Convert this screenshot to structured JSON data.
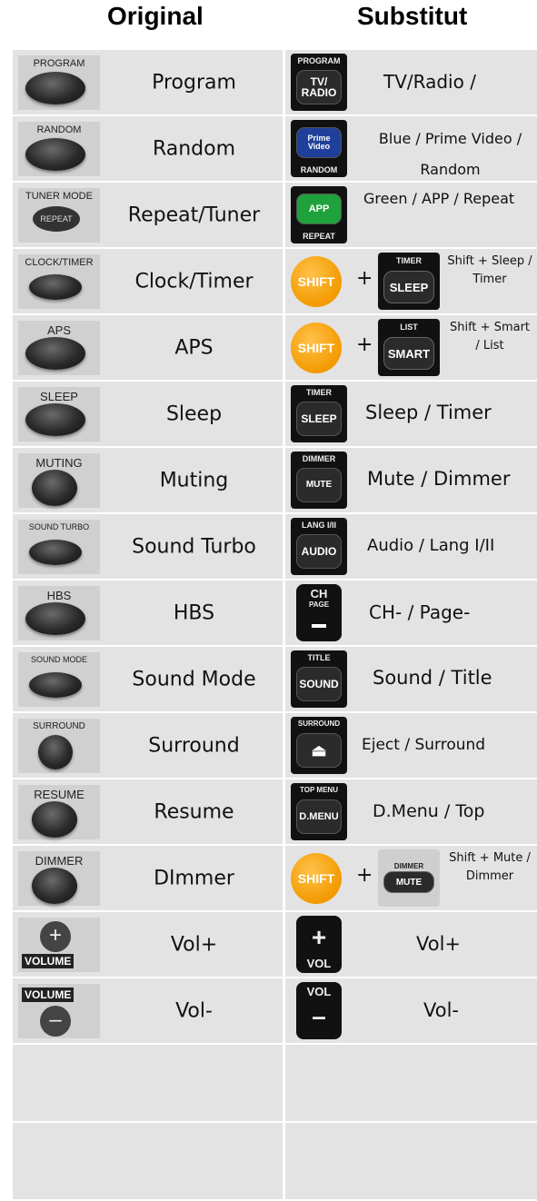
{
  "headers": {
    "original": "Original",
    "substitut": "Substitut"
  },
  "rows": [
    {
      "orig": {
        "label": "Program",
        "tag": "PROGRAM"
      },
      "sub": {
        "label": "TV/Radio /",
        "top": "PROGRAM",
        "btn": "TV/ RADIO"
      }
    },
    {
      "orig": {
        "label": "Random",
        "tag": "RANDOM"
      },
      "sub": {
        "label": "Blue / Prime Video / Random",
        "btn": "Prime Video",
        "bottom": "RANDOM"
      }
    },
    {
      "orig": {
        "label": "Repeat/Tuner",
        "tag": "TUNER MODE",
        "inner": "REPEAT"
      },
      "sub": {
        "label": "Green / APP / Repeat",
        "btn": "APP",
        "bottom": "REPEAT"
      }
    },
    {
      "orig": {
        "label": "Clock/Timer",
        "tag": "CLOCK/TIMER"
      },
      "sub": {
        "shift": "SHIFT",
        "plus": "+",
        "top": "TIMER",
        "btn": "SLEEP",
        "label": "Shift + Sleep / Timer"
      }
    },
    {
      "orig": {
        "label": "APS",
        "tag": "APS"
      },
      "sub": {
        "shift": "SHIFT",
        "plus": "+",
        "top": "LIST",
        "btn": "SMART",
        "label": "Shift + Smart / List"
      }
    },
    {
      "orig": {
        "label": "Sleep",
        "tag": "SLEEP"
      },
      "sub": {
        "label": "Sleep / Timer",
        "top": "TIMER",
        "btn": "SLEEP"
      }
    },
    {
      "orig": {
        "label": "Muting",
        "tag": "MUTING"
      },
      "sub": {
        "label": "Mute / Dimmer",
        "top": "DIMMER",
        "btn": "MUTE"
      }
    },
    {
      "orig": {
        "label": "Sound Turbo",
        "tag": "SOUND TURBO"
      },
      "sub": {
        "label": "Audio / Lang I/II",
        "top": "LANG I/II",
        "btn": "AUDIO"
      }
    },
    {
      "orig": {
        "label": "HBS",
        "tag": "HBS"
      },
      "sub": {
        "label": "CH- / Page-",
        "top": "CH",
        "btn": "PAGE"
      }
    },
    {
      "orig": {
        "label": "Sound Mode",
        "tag": "SOUND MODE"
      },
      "sub": {
        "label": "Sound / Title",
        "top": "TITLE",
        "btn": "SOUND"
      }
    },
    {
      "orig": {
        "label": "Surround",
        "tag": "SURROUND"
      },
      "sub": {
        "label": "Eject / Surround",
        "top": "SURROUND",
        "btn": "⏏"
      }
    },
    {
      "orig": {
        "label": "Resume",
        "tag": "RESUME"
      },
      "sub": {
        "label": "D.Menu / Top",
        "top": "TOP MENU",
        "btn": "D.MENU"
      }
    },
    {
      "orig": {
        "label": "DImmer",
        "tag": "DIMMER"
      },
      "sub": {
        "shift": "SHIFT",
        "plus": "+",
        "top": "DIMMER",
        "btn": "MUTE",
        "label": "Shift + Mute / Dimmer"
      }
    },
    {
      "orig": {
        "label": "Vol+",
        "tag": "VOLUME",
        "sym": "+"
      },
      "sub": {
        "label": "Vol+",
        "btn": "+",
        "bottom": "VOL"
      }
    },
    {
      "orig": {
        "label": "Vol-",
        "tag": "VOLUME",
        "sym": "–"
      },
      "sub": {
        "label": "Vol-",
        "top": "VOL",
        "btn": "–"
      }
    }
  ]
}
